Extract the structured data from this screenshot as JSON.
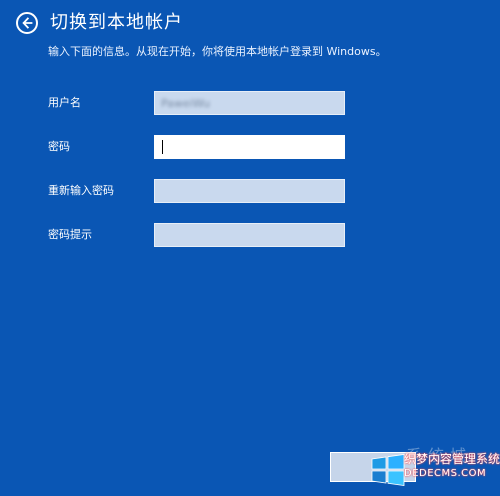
{
  "header": {
    "title": "切换到本地帐户",
    "subtitle": "输入下面的信息。从现在开始，你将使用本地帐户登录到 Windows。"
  },
  "form": {
    "username": {
      "label": "用户名",
      "value": "PaweiWu"
    },
    "password": {
      "label": "密码",
      "value": ""
    },
    "confirm_password": {
      "label": "重新输入密码",
      "value": ""
    },
    "password_hint": {
      "label": "密码提示",
      "value": ""
    }
  },
  "watermark": {
    "line1": "织梦内容管理系统",
    "line2": "DEDECMS.COM",
    "faint": "系统城"
  },
  "colors": {
    "background": "#0a56b4",
    "input_inactive": "#c9d9ee",
    "input_active": "#ffffff"
  },
  "icons": {
    "back": "back-arrow-icon",
    "watermark": "windows-logo-icon"
  }
}
